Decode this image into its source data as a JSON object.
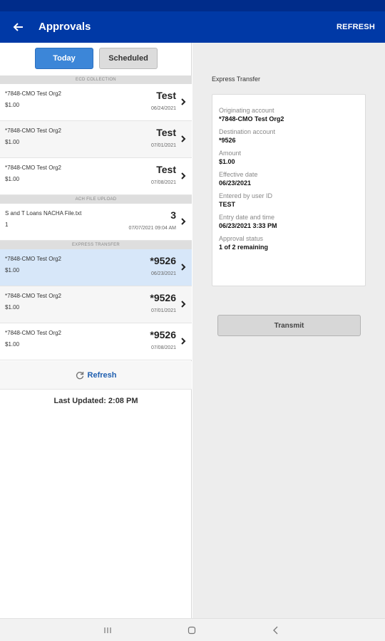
{
  "app_bar": {
    "title": "Approvals",
    "refresh_label": "REFRESH"
  },
  "tabs": {
    "today": "Today",
    "scheduled": "Scheduled"
  },
  "sections": [
    {
      "header": "ECD COLLECTION",
      "items": [
        {
          "name": "*7848-CMO Test Org2",
          "sub": "$1.00",
          "value": "Test",
          "date": "06/24/2021"
        },
        {
          "name": "*7848-CMO Test Org2",
          "sub": "$1.00",
          "value": "Test",
          "date": "07/01/2021"
        },
        {
          "name": "*7848-CMO Test Org2",
          "sub": "$1.00",
          "value": "Test",
          "date": "07/08/2021"
        }
      ]
    },
    {
      "header": "ACH FILE UPLOAD",
      "items": [
        {
          "name": "S and T Loans NACHA File.txt",
          "sub": "1",
          "value": "3",
          "date": "07/07/2021 09:04 AM"
        }
      ]
    },
    {
      "header": "EXPRESS TRANSFER",
      "items": [
        {
          "name": "*7848-CMO Test Org2",
          "sub": "$1.00",
          "value": "*9526",
          "date": "06/23/2021"
        },
        {
          "name": "*7848-CMO Test Org2",
          "sub": "$1.00",
          "value": "*9526",
          "date": "07/01/2021"
        },
        {
          "name": "*7848-CMO Test Org2",
          "sub": "$1.00",
          "value": "*9526",
          "date": "07/08/2021"
        }
      ]
    }
  ],
  "refresh_link": "Refresh",
  "last_updated": "Last Updated: 2:08 PM",
  "detail": {
    "title": "Express Transfer",
    "fields": [
      {
        "label": "Originating account",
        "value": "*7848-CMO Test Org2"
      },
      {
        "label": "Destination account",
        "value": "*9526"
      },
      {
        "label": "Amount",
        "value": "$1.00"
      },
      {
        "label": "Effective date",
        "value": "06/23/2021"
      },
      {
        "label": "Entered by user ID",
        "value": "TEST"
      },
      {
        "label": "Entry date and time",
        "value": "06/23/2021 3:33 PM"
      },
      {
        "label": "Approval status",
        "value": "1 of 2 remaining"
      }
    ],
    "transmit_label": "Transmit"
  },
  "colors": {
    "brand": "#0039a6",
    "selected": "#d7e7f9",
    "accent": "#3c86d8"
  },
  "icons": {
    "back": "arrow-left-icon",
    "chevron": "chevron-right-icon",
    "refresh": "refresh-icon"
  }
}
